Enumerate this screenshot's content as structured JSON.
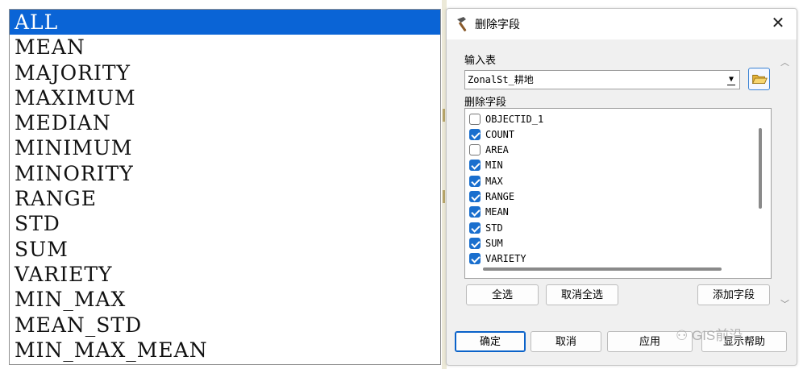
{
  "stat_list": {
    "items": [
      "ALL",
      "MEAN",
      "MAJORITY",
      "MAXIMUM",
      "MEDIAN",
      "MINIMUM",
      "MINORITY",
      "RANGE",
      "STD",
      "SUM",
      "VARIETY",
      "MIN_MAX",
      "MEAN_STD",
      "MIN_MAX_MEAN"
    ],
    "selected_index": 0
  },
  "dialog": {
    "title": "删除字段",
    "input_table_label": "输入表",
    "input_table_value": "ZonalSt_耕地",
    "drop_fields_label": "删除字段",
    "fields": [
      {
        "name": "OBJECTID_1",
        "checked": false
      },
      {
        "name": "COUNT",
        "checked": true
      },
      {
        "name": "AREA",
        "checked": false
      },
      {
        "name": "MIN",
        "checked": true
      },
      {
        "name": "MAX",
        "checked": true
      },
      {
        "name": "RANGE",
        "checked": true
      },
      {
        "name": "MEAN",
        "checked": true
      },
      {
        "name": "STD",
        "checked": true
      },
      {
        "name": "SUM",
        "checked": true
      },
      {
        "name": "VARIETY",
        "checked": true
      }
    ],
    "select_all_label": "全选",
    "unselect_all_label": "取消全选",
    "add_field_label": "添加字段",
    "ok_label": "确定",
    "cancel_label": "取消",
    "apply_label": "应用",
    "help_label": "显示帮助",
    "close_symbol": "✕"
  },
  "watermark": {
    "text": "GIS前沿"
  },
  "colors": {
    "selection": "#0a64d6",
    "checkbox": "#1a6fce"
  }
}
